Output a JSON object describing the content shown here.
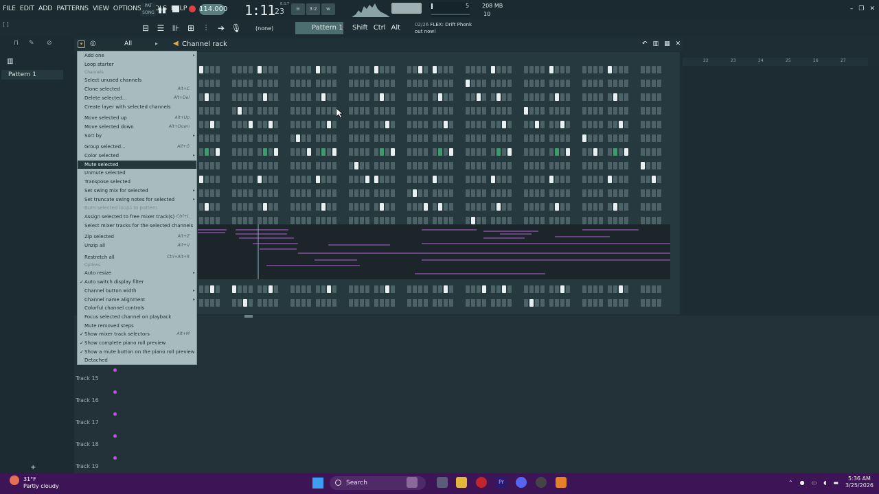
{
  "menu": [
    "FILE",
    "EDIT",
    "ADD",
    "PATTERNS",
    "VIEW",
    "OPTIONS",
    "TOOLS",
    "HELP"
  ],
  "transport": {
    "song_mode": "PAT SONG",
    "tempo": "114.000",
    "time": "1:11",
    "time_fraction": "23",
    "time_label": "B:S:T"
  },
  "pattern_modes": [
    "≡",
    "3:2",
    "w"
  ],
  "system": {
    "cpu": "5",
    "cpu_poly": "10",
    "memory": "208 MB"
  },
  "toolbar": {
    "hint": "[ ]",
    "preset": "(none)",
    "pattern": "Pattern 1",
    "modifiers": [
      "Shift",
      "Ctrl",
      "Alt"
    ],
    "news_date": "02/26",
    "news_text": "FLEX: Drift Phonk",
    "news_sub": "out now!"
  },
  "left": {
    "pattern_tab": "Pattern 1"
  },
  "channel_rack": {
    "filter": "All",
    "title": "Channel rack"
  },
  "ruler_numbers": [
    "22",
    "23",
    "24",
    "25",
    "26",
    "27"
  ],
  "context_menu": [
    {
      "label": "Add one",
      "type": "sub"
    },
    {
      "label": "Loop starter",
      "type": "item"
    },
    {
      "label": "Channels",
      "type": "section"
    },
    {
      "label": "Select unused channels",
      "type": "item"
    },
    {
      "label": "Clone selected",
      "shortcut": "Alt+C",
      "type": "item"
    },
    {
      "label": "Delete selected...",
      "shortcut": "Alt+Del",
      "type": "item"
    },
    {
      "label": "Create layer with selected channels",
      "type": "item"
    },
    {
      "label": "",
      "type": "gap"
    },
    {
      "label": "Move selected up",
      "shortcut": "Alt+Up",
      "type": "item"
    },
    {
      "label": "Move selected down",
      "shortcut": "Alt+Down",
      "type": "item"
    },
    {
      "label": "Sort by",
      "type": "sub"
    },
    {
      "label": "",
      "type": "gap"
    },
    {
      "label": "Group selected...",
      "shortcut": "Alt+G",
      "type": "item"
    },
    {
      "label": "Color selected",
      "type": "sub"
    },
    {
      "label": "Mute selected",
      "type": "highlight"
    },
    {
      "label": "Unmute selected",
      "type": "item"
    },
    {
      "label": "Transpose selected",
      "type": "item"
    },
    {
      "label": "Set swing mix for selected",
      "type": "sub"
    },
    {
      "label": "Set truncate swing notes for selected",
      "type": "sub"
    },
    {
      "label": "Burn selected loops to pattern",
      "type": "disabled"
    },
    {
      "label": "Assign selected to free mixer track(s)",
      "shortcut": "Ctrl+L",
      "type": "item"
    },
    {
      "label": "Select mixer tracks for the selected channels",
      "type": "item"
    },
    {
      "label": "",
      "type": "gap"
    },
    {
      "label": "Zip selected",
      "shortcut": "Alt+Z",
      "type": "item"
    },
    {
      "label": "Unzip all",
      "shortcut": "Alt+U",
      "type": "item"
    },
    {
      "label": "",
      "type": "gap"
    },
    {
      "label": "Restretch all",
      "shortcut": "Ctrl+Alt+R",
      "type": "item"
    },
    {
      "label": "Options",
      "type": "section"
    },
    {
      "label": "Auto resize",
      "type": "sub"
    },
    {
      "label": "Auto switch display filter",
      "type": "check"
    },
    {
      "label": "Channel button width",
      "type": "sub"
    },
    {
      "label": "Channel name alignment",
      "type": "sub"
    },
    {
      "label": "Colorful channel controls",
      "type": "item"
    },
    {
      "label": "Focus selected channel on playback",
      "type": "item"
    },
    {
      "label": "Mute removed steps",
      "type": "item"
    },
    {
      "label": "Show mixer track selectors",
      "shortcut": "Alt+M",
      "type": "check"
    },
    {
      "label": "Show complete piano roll preview",
      "type": "check"
    },
    {
      "label": "Show a mute button on the piano roll preview",
      "type": "check"
    },
    {
      "label": "Detached",
      "type": "item"
    }
  ],
  "tracks": [
    "Track 15",
    "Track 16",
    "Track 17",
    "Track 18",
    "Track 19"
  ],
  "taskbar": {
    "temperature": "31°F",
    "weather": "Partly cloudy",
    "search": "Search",
    "time": "5:36 AM",
    "date": "3/25/2026"
  }
}
